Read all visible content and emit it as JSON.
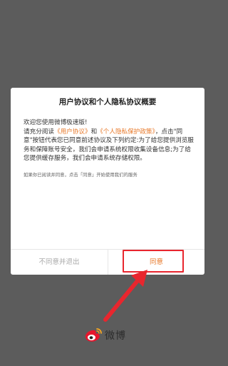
{
  "dialog": {
    "title": "用户协议和个人隐私协议概要",
    "greeting": "欢迎您使用微博极速版!",
    "body_before_link1": "请充分阅读",
    "link_user_agreement": "《用户协议》",
    "body_and": "和",
    "link_privacy_policy": "《个人隐私保护政策》",
    "body_after_links": "，点击\"同意\"按钮代表您已同意前述协议及下列约定:为了给您提供浏览服务和保障账号安全，我们会申请系统权限收集设备信息;为了给您提供缓存服务，我们会申请系统存储权限。",
    "note": "如果你已阅读并同意，点击「同意」开始使用我们的服务",
    "cancel_label": "不同意并退出",
    "agree_label": "同意"
  },
  "brand": {
    "name": "微博",
    "logo_icon": "weibo-logo-icon"
  },
  "colors": {
    "accent": "#e8792a",
    "annotation_red": "#e8262e",
    "overlay": "#5c5c5c"
  }
}
